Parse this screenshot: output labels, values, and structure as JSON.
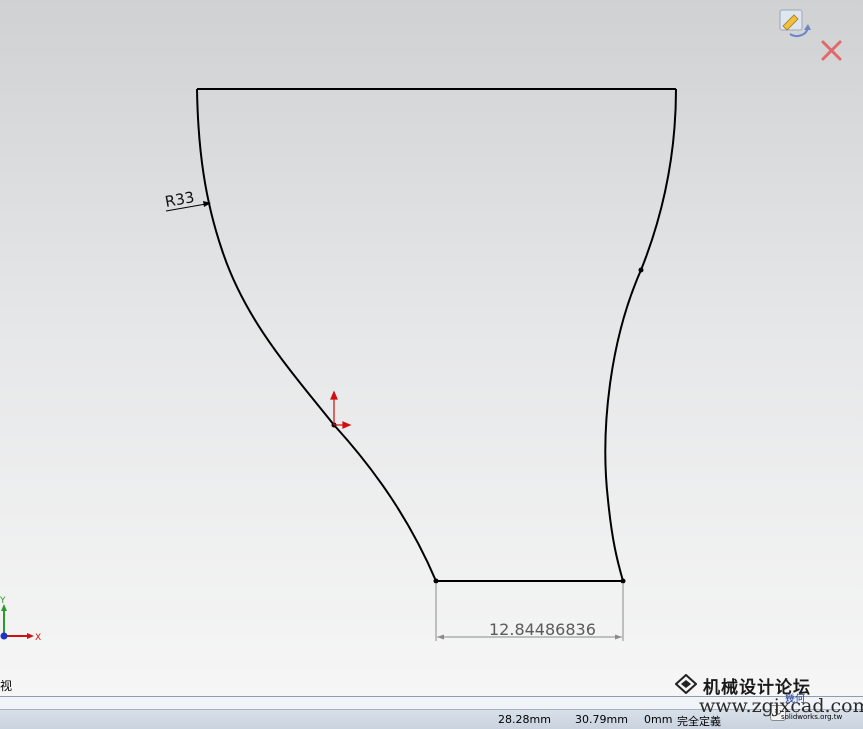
{
  "sketch": {
    "radius_dimension": "R33",
    "linear_dimension": "12.84486836"
  },
  "triad": {
    "x_label": "X",
    "y_label": "Y"
  },
  "view_label": "视",
  "statusbar": {
    "coord_x": "28.28mm",
    "coord_y": "30.79mm",
    "coord_z": "0mm",
    "sketch_status": "完全定義"
  },
  "watermark": {
    "title": "机械设计论坛",
    "url": "www.zgjxcad.com",
    "small_text": "solidworks.org.tw",
    "badge": "幾何"
  },
  "icons": {
    "confirm": "sketch-confirm-icon",
    "cancel": "close-icon"
  },
  "colors": {
    "sketch_line": "#000000",
    "origin_arrow": "#d01010",
    "axis_x": "#d01010",
    "axis_y": "#2a9a2a",
    "cancel_x": "#e06a6a"
  }
}
